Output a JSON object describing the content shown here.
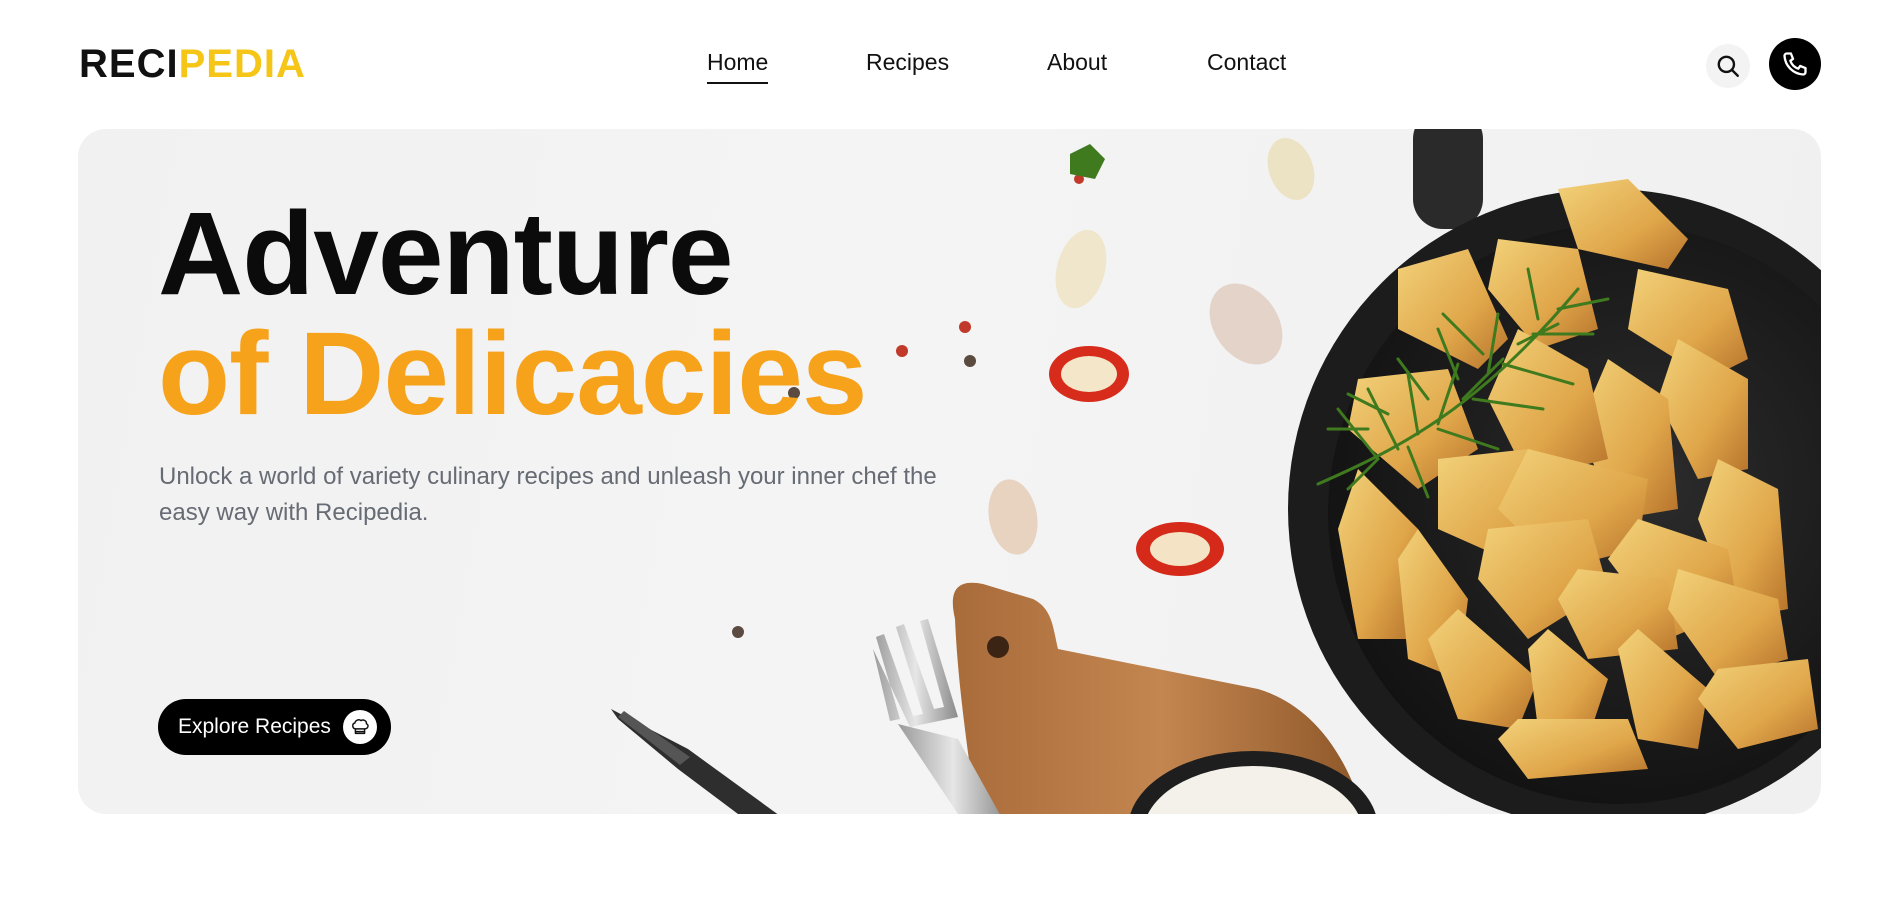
{
  "logo": {
    "part1": "RECI",
    "part2": "PEDIA"
  },
  "nav": {
    "home": "Home",
    "recipes": "Recipes",
    "about": "About",
    "contact": "Contact"
  },
  "header_icons": {
    "search": "search-icon",
    "phone": "phone-icon"
  },
  "hero": {
    "title_line1": "Adventure",
    "title_line2": "of Delicacies",
    "subtitle": "Unlock a world of variety culinary recipes and unleash your inner chef the easy way with Recipedia.",
    "cta_label": "Explore Recipes",
    "cta_icon": "chef-hat-icon",
    "image": "potato-wedges-in-cast-iron-pan"
  },
  "colors": {
    "brand_yellow": "#f5c518",
    "accent_orange": "#f7a21b",
    "text_dark": "#111111",
    "text_muted": "#666b74"
  }
}
